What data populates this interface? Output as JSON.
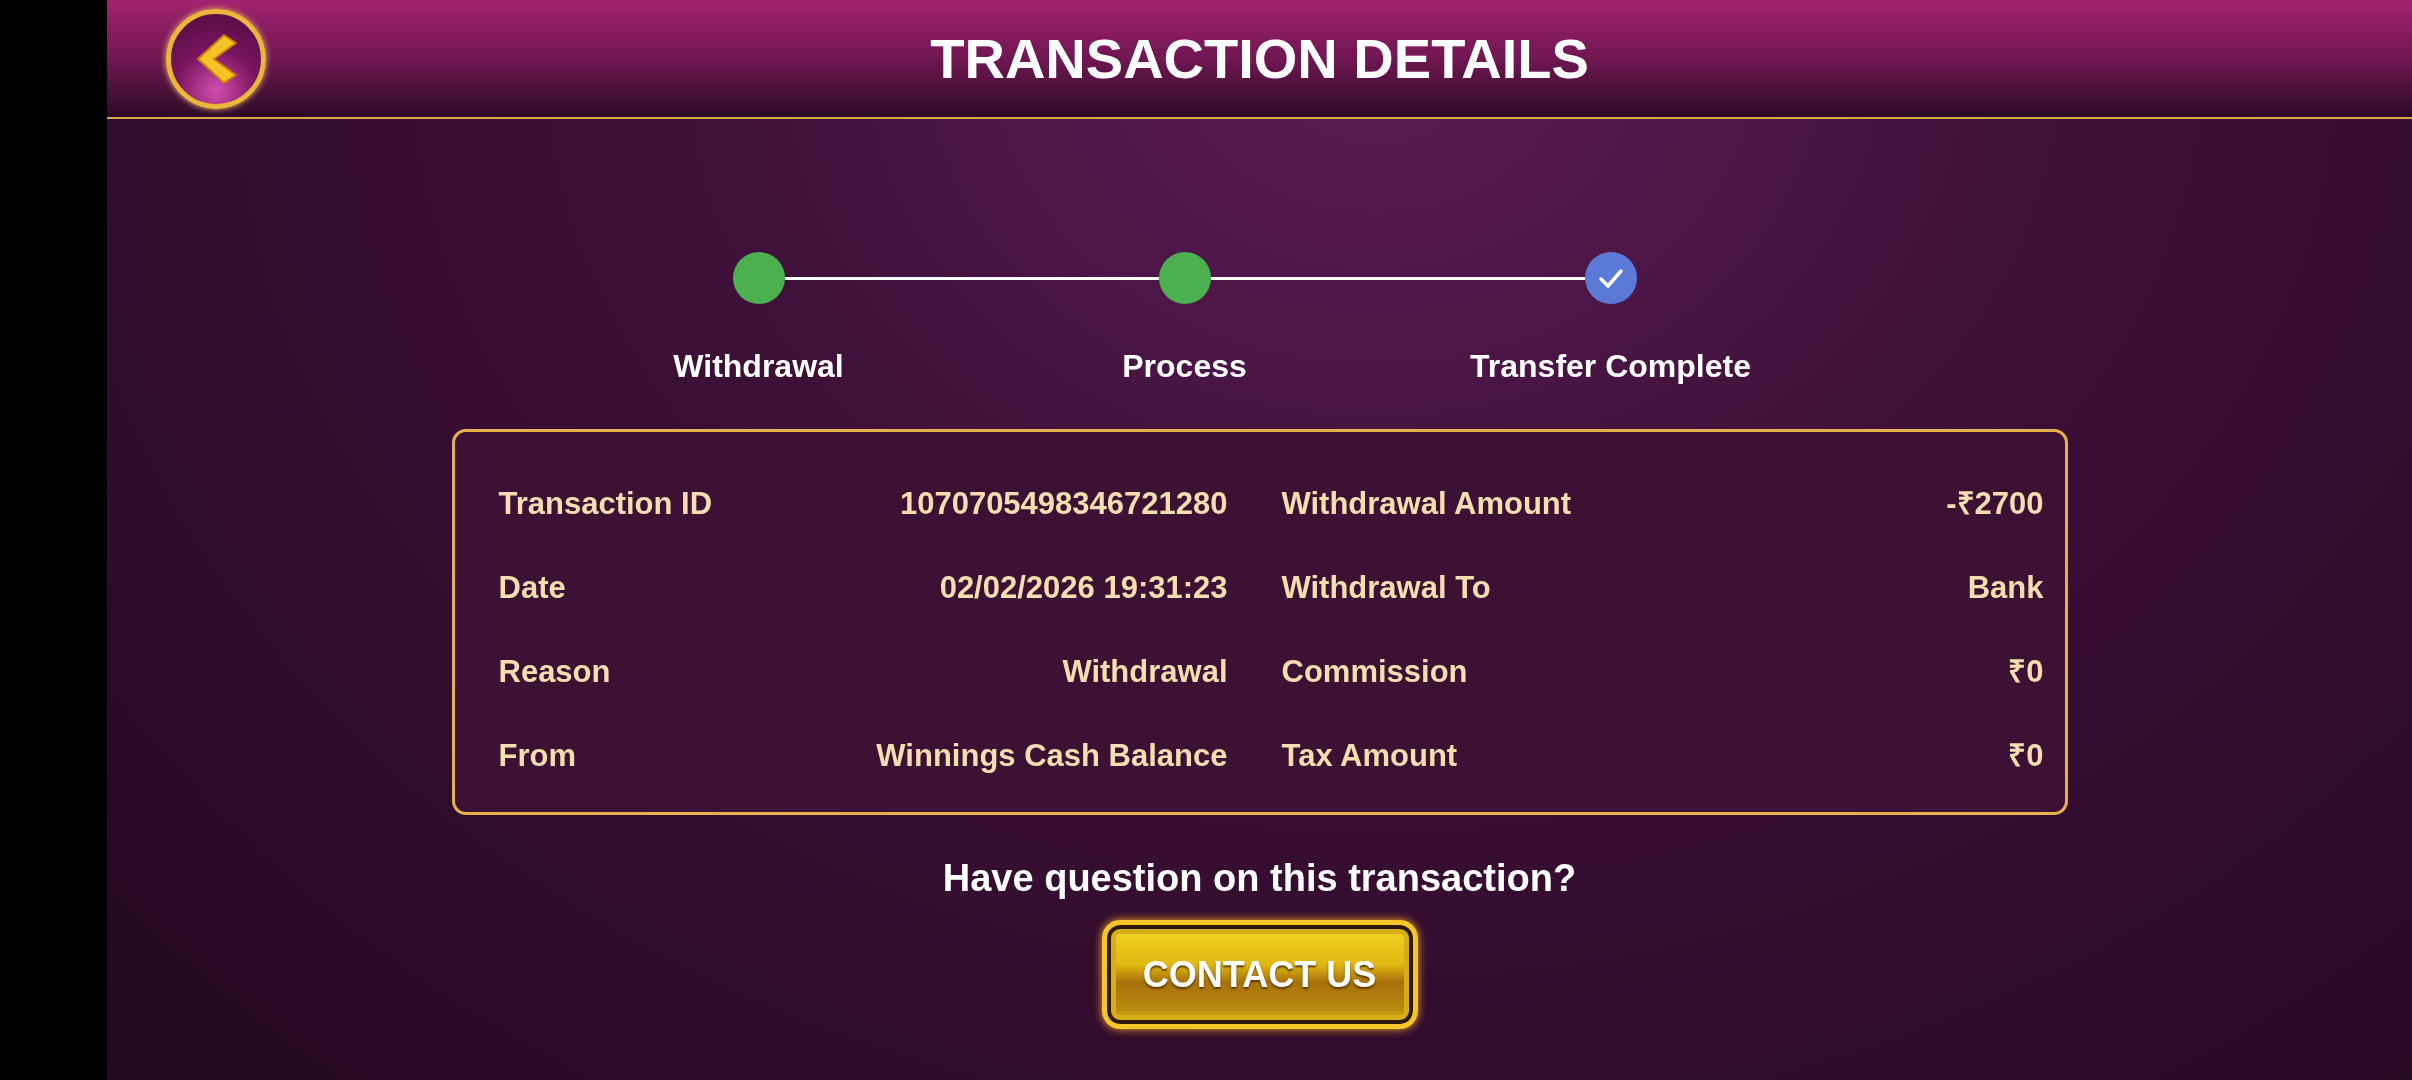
{
  "header": {
    "title": "TRANSACTION DETAILS"
  },
  "steps": [
    {
      "label": "Withdrawal",
      "selected": false
    },
    {
      "label": "Process",
      "selected": false
    },
    {
      "label": "Transfer Complete",
      "selected": true
    }
  ],
  "details": {
    "left_items": [
      {
        "label": "Transaction ID",
        "value": "1070705498346721280"
      },
      {
        "label": "Date",
        "value": "02/02/2026 19:31:23"
      },
      {
        "label": "Reason",
        "value": "Withdrawal"
      },
      {
        "label": "From",
        "value": "Winnings Cash Balance"
      }
    ],
    "right_items": [
      {
        "label": "Withdrawal Amount",
        "value": "-₹2700"
      },
      {
        "label": "Withdrawal To",
        "value": "Bank"
      },
      {
        "label": "Commission",
        "value": "₹0"
      },
      {
        "label": "Tax Amount",
        "value": "₹0"
      }
    ]
  },
  "footer": {
    "question": "Have question on this transaction?",
    "button": "CONTACT US"
  }
}
